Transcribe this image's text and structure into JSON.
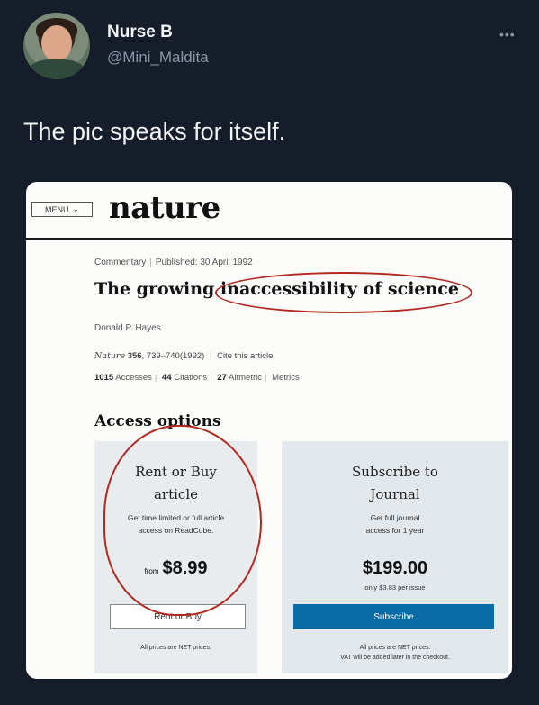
{
  "tweet": {
    "display_name": "Nurse B",
    "handle": "@Mini_Maldita",
    "more_glyph": "•••",
    "text": "The pic speaks for itself."
  },
  "article": {
    "menu_label": "MENU",
    "menu_chevron": "⌄",
    "logo": "nature",
    "article_type": "Commentary",
    "published": "Published: 30 April 1992",
    "title": "The growing inaccessibility of science",
    "author": "Donald P. Hayes",
    "journal": "Nature",
    "volume": "356",
    "pages": "739–740(1992)",
    "cite_link": "Cite this article",
    "accesses_count": "1015",
    "accesses_label": "Accesses",
    "citations_count": "44",
    "citations_label": "Citations",
    "altmetric_count": "27",
    "altmetric_label": "Altmetric",
    "metrics_link": "Metrics",
    "access_heading": "Access options"
  },
  "options": {
    "rent": {
      "title_line1": "Rent or Buy",
      "title_line2": "article",
      "desc_line1": "Get time limited or full article",
      "desc_line2": "access on ReadCube.",
      "from_label": "from",
      "price": "$8.99",
      "button": "Rent or Buy",
      "net_note": "All prices are NET prices."
    },
    "subscribe": {
      "title_line1": "Subscribe to",
      "title_line2": "Journal",
      "desc_line1": "Get full journal",
      "desc_line2": "access for 1 year",
      "price": "$199.00",
      "per_issue": "only $3.83 per issue",
      "button": "Subscribe",
      "net_note1": "All prices are NET prices.",
      "net_note2": "VAT will be added later in the checkout."
    }
  },
  "colors": {
    "background": "#151d2a",
    "annotation_red": "#b3281f",
    "subscribe_blue": "#0a6ba6"
  }
}
